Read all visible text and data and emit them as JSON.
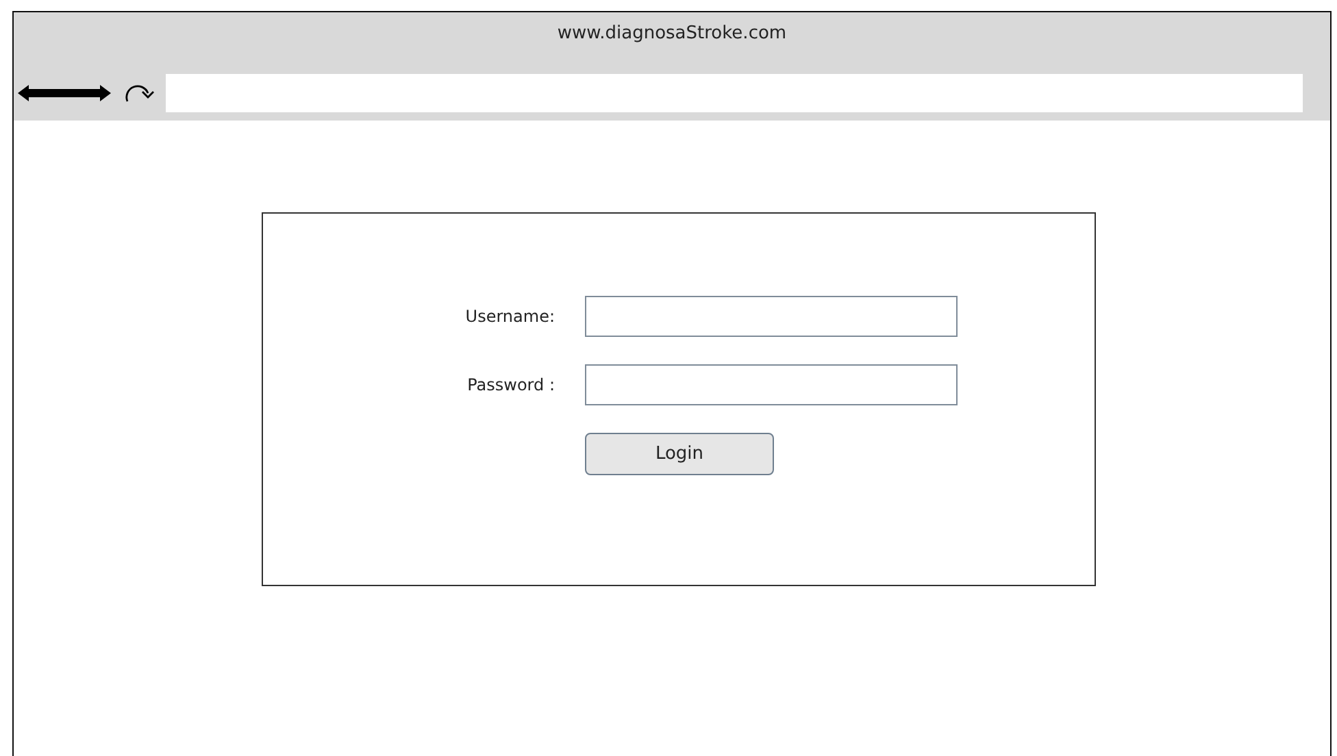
{
  "browser": {
    "title": "www.diagnosaStroke.com"
  },
  "login_form": {
    "fields": [
      {
        "label": "Username:"
      },
      {
        "label": "Password :"
      }
    ],
    "button": "Login"
  }
}
